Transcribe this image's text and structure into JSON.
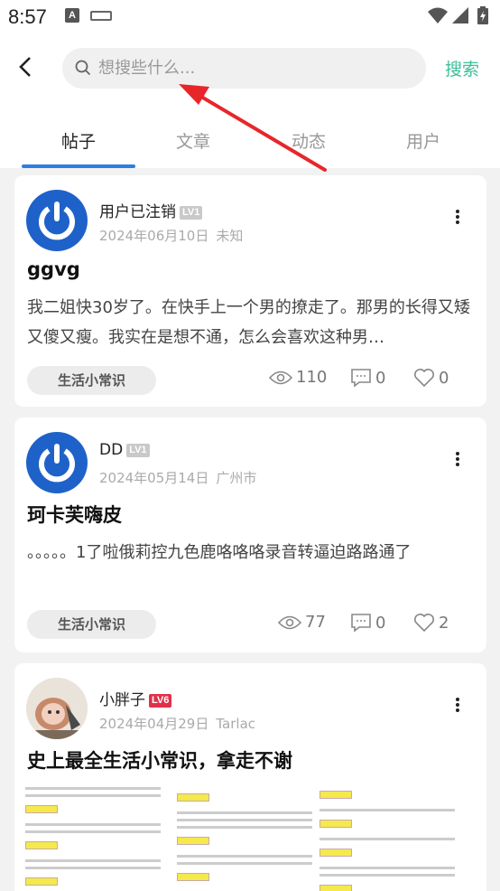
{
  "status_bar": {
    "time": "8:57",
    "a_icon": "A"
  },
  "search": {
    "placeholder": "想搜些什么...",
    "value": "",
    "button_label": "搜索"
  },
  "tabs": [
    {
      "label": "帖子",
      "active": true
    },
    {
      "label": "文章",
      "active": false
    },
    {
      "label": "动态",
      "active": false
    },
    {
      "label": "用户",
      "active": false
    }
  ],
  "posts": [
    {
      "username": "用户已注销",
      "level": "LV1",
      "date": "2024年06月10日",
      "location": "未知",
      "title": "ggvg",
      "body": "我二姐快30岁了。在快手上一个男的撩走了。那男的长得又矮又傻又瘦。我实在是想不通，怎么会喜欢这种男…",
      "tag": "生活小常识",
      "views": "110",
      "comments": "0",
      "likes": "0"
    },
    {
      "username": "DD",
      "level": "LV1",
      "date": "2024年05月14日",
      "location": "广州市",
      "title": "珂卡芙嗨皮",
      "body": "。。。。。1了啦俄莉控九色鹿咯咯咯录音转逼迫路路通了",
      "tag": "生活小常识",
      "views": "77",
      "comments": "0",
      "likes": "2"
    },
    {
      "username": "小胖子",
      "level": "LV6",
      "date": "2024年04月29日",
      "location": "Tarlac",
      "title": "史上最全生活小常识，拿走不谢"
    }
  ],
  "colors": {
    "accent": "#2c7fe0",
    "search_button": "#3cbf9a",
    "arrow": "#e8262a",
    "avatar_blue": "#1e62c9"
  }
}
